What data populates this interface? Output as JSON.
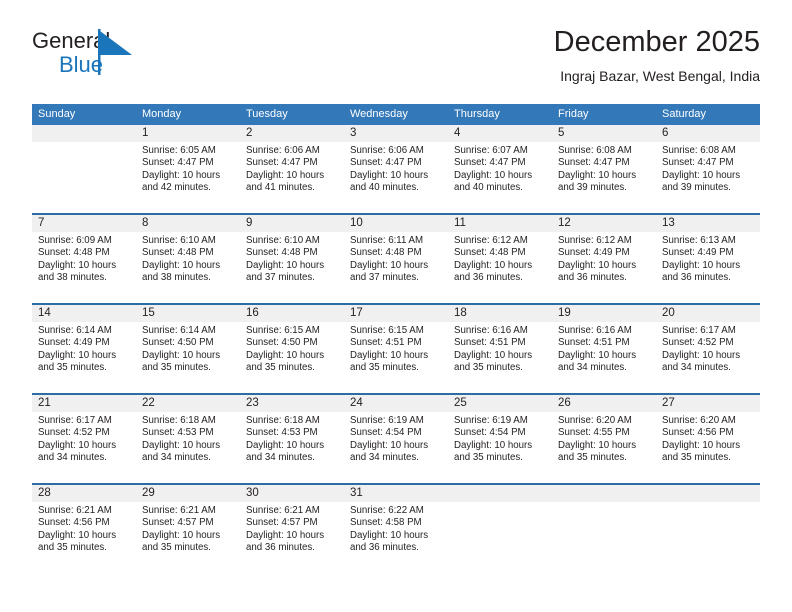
{
  "brand": {
    "name_dark": "General",
    "name_blue": "Blue",
    "mark": "triangle-logo",
    "accent_color": "#1b75bb"
  },
  "header": {
    "title": "December 2025",
    "location": "Ingraj Bazar, West Bengal, India"
  },
  "theme": {
    "header_blue": "#3378b8",
    "row_divider_blue": "#2e6da4",
    "day_number_band": "#f0f0f0",
    "text": "#231f20"
  },
  "calendar": {
    "weekdays": [
      "Sunday",
      "Monday",
      "Tuesday",
      "Wednesday",
      "Thursday",
      "Friday",
      "Saturday"
    ],
    "weeks": [
      [
        {
          "day": "",
          "lines": []
        },
        {
          "day": "1",
          "lines": [
            "Sunrise: 6:05 AM",
            "Sunset: 4:47 PM",
            "Daylight: 10 hours",
            "and 42 minutes."
          ]
        },
        {
          "day": "2",
          "lines": [
            "Sunrise: 6:06 AM",
            "Sunset: 4:47 PM",
            "Daylight: 10 hours",
            "and 41 minutes."
          ]
        },
        {
          "day": "3",
          "lines": [
            "Sunrise: 6:06 AM",
            "Sunset: 4:47 PM",
            "Daylight: 10 hours",
            "and 40 minutes."
          ]
        },
        {
          "day": "4",
          "lines": [
            "Sunrise: 6:07 AM",
            "Sunset: 4:47 PM",
            "Daylight: 10 hours",
            "and 40 minutes."
          ]
        },
        {
          "day": "5",
          "lines": [
            "Sunrise: 6:08 AM",
            "Sunset: 4:47 PM",
            "Daylight: 10 hours",
            "and 39 minutes."
          ]
        },
        {
          "day": "6",
          "lines": [
            "Sunrise: 6:08 AM",
            "Sunset: 4:47 PM",
            "Daylight: 10 hours",
            "and 39 minutes."
          ]
        }
      ],
      [
        {
          "day": "7",
          "lines": [
            "Sunrise: 6:09 AM",
            "Sunset: 4:48 PM",
            "Daylight: 10 hours",
            "and 38 minutes."
          ]
        },
        {
          "day": "8",
          "lines": [
            "Sunrise: 6:10 AM",
            "Sunset: 4:48 PM",
            "Daylight: 10 hours",
            "and 38 minutes."
          ]
        },
        {
          "day": "9",
          "lines": [
            "Sunrise: 6:10 AM",
            "Sunset: 4:48 PM",
            "Daylight: 10 hours",
            "and 37 minutes."
          ]
        },
        {
          "day": "10",
          "lines": [
            "Sunrise: 6:11 AM",
            "Sunset: 4:48 PM",
            "Daylight: 10 hours",
            "and 37 minutes."
          ]
        },
        {
          "day": "11",
          "lines": [
            "Sunrise: 6:12 AM",
            "Sunset: 4:48 PM",
            "Daylight: 10 hours",
            "and 36 minutes."
          ]
        },
        {
          "day": "12",
          "lines": [
            "Sunrise: 6:12 AM",
            "Sunset: 4:49 PM",
            "Daylight: 10 hours",
            "and 36 minutes."
          ]
        },
        {
          "day": "13",
          "lines": [
            "Sunrise: 6:13 AM",
            "Sunset: 4:49 PM",
            "Daylight: 10 hours",
            "and 36 minutes."
          ]
        }
      ],
      [
        {
          "day": "14",
          "lines": [
            "Sunrise: 6:14 AM",
            "Sunset: 4:49 PM",
            "Daylight: 10 hours",
            "and 35 minutes."
          ]
        },
        {
          "day": "15",
          "lines": [
            "Sunrise: 6:14 AM",
            "Sunset: 4:50 PM",
            "Daylight: 10 hours",
            "and 35 minutes."
          ]
        },
        {
          "day": "16",
          "lines": [
            "Sunrise: 6:15 AM",
            "Sunset: 4:50 PM",
            "Daylight: 10 hours",
            "and 35 minutes."
          ]
        },
        {
          "day": "17",
          "lines": [
            "Sunrise: 6:15 AM",
            "Sunset: 4:51 PM",
            "Daylight: 10 hours",
            "and 35 minutes."
          ]
        },
        {
          "day": "18",
          "lines": [
            "Sunrise: 6:16 AM",
            "Sunset: 4:51 PM",
            "Daylight: 10 hours",
            "and 35 minutes."
          ]
        },
        {
          "day": "19",
          "lines": [
            "Sunrise: 6:16 AM",
            "Sunset: 4:51 PM",
            "Daylight: 10 hours",
            "and 34 minutes."
          ]
        },
        {
          "day": "20",
          "lines": [
            "Sunrise: 6:17 AM",
            "Sunset: 4:52 PM",
            "Daylight: 10 hours",
            "and 34 minutes."
          ]
        }
      ],
      [
        {
          "day": "21",
          "lines": [
            "Sunrise: 6:17 AM",
            "Sunset: 4:52 PM",
            "Daylight: 10 hours",
            "and 34 minutes."
          ]
        },
        {
          "day": "22",
          "lines": [
            "Sunrise: 6:18 AM",
            "Sunset: 4:53 PM",
            "Daylight: 10 hours",
            "and 34 minutes."
          ]
        },
        {
          "day": "23",
          "lines": [
            "Sunrise: 6:18 AM",
            "Sunset: 4:53 PM",
            "Daylight: 10 hours",
            "and 34 minutes."
          ]
        },
        {
          "day": "24",
          "lines": [
            "Sunrise: 6:19 AM",
            "Sunset: 4:54 PM",
            "Daylight: 10 hours",
            "and 34 minutes."
          ]
        },
        {
          "day": "25",
          "lines": [
            "Sunrise: 6:19 AM",
            "Sunset: 4:54 PM",
            "Daylight: 10 hours",
            "and 35 minutes."
          ]
        },
        {
          "day": "26",
          "lines": [
            "Sunrise: 6:20 AM",
            "Sunset: 4:55 PM",
            "Daylight: 10 hours",
            "and 35 minutes."
          ]
        },
        {
          "day": "27",
          "lines": [
            "Sunrise: 6:20 AM",
            "Sunset: 4:56 PM",
            "Daylight: 10 hours",
            "and 35 minutes."
          ]
        }
      ],
      [
        {
          "day": "28",
          "lines": [
            "Sunrise: 6:21 AM",
            "Sunset: 4:56 PM",
            "Daylight: 10 hours",
            "and 35 minutes."
          ]
        },
        {
          "day": "29",
          "lines": [
            "Sunrise: 6:21 AM",
            "Sunset: 4:57 PM",
            "Daylight: 10 hours",
            "and 35 minutes."
          ]
        },
        {
          "day": "30",
          "lines": [
            "Sunrise: 6:21 AM",
            "Sunset: 4:57 PM",
            "Daylight: 10 hours",
            "and 36 minutes."
          ]
        },
        {
          "day": "31",
          "lines": [
            "Sunrise: 6:22 AM",
            "Sunset: 4:58 PM",
            "Daylight: 10 hours",
            "and 36 minutes."
          ]
        },
        {
          "day": "",
          "lines": []
        },
        {
          "day": "",
          "lines": []
        },
        {
          "day": "",
          "lines": []
        }
      ]
    ]
  }
}
